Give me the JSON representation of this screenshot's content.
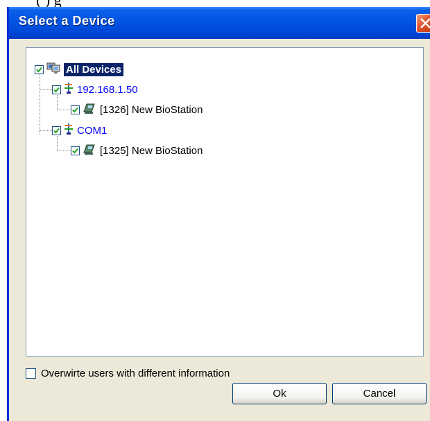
{
  "background_text": "(                 ) g",
  "dialog": {
    "title": "Select a Device",
    "close_icon": "close-icon"
  },
  "tree": {
    "root": {
      "label": "All Devices",
      "checked": true,
      "icon": "computers-icon",
      "selected": true
    },
    "nodes": [
      {
        "label": "192.168.1.50",
        "checked": true,
        "icon": "network-icon",
        "level": 1
      },
      {
        "label": "[1326] New BioStation",
        "checked": true,
        "icon": "device-icon",
        "level": 2
      },
      {
        "label": "COM1",
        "checked": true,
        "icon": "network-icon",
        "level": 1
      },
      {
        "label": "[1325] New BioStation",
        "checked": true,
        "icon": "device-icon",
        "level": 2
      }
    ]
  },
  "options": {
    "overwrite_label": "Overwirte users with different information",
    "overwrite_checked": false
  },
  "buttons": {
    "ok_label": "Ok",
    "cancel_label": "Cancel"
  },
  "colors": {
    "title_bar": "#0254e3",
    "link_blue": "#0000ff",
    "selection": "#0a246a",
    "dialog_face": "#ece9d8"
  }
}
